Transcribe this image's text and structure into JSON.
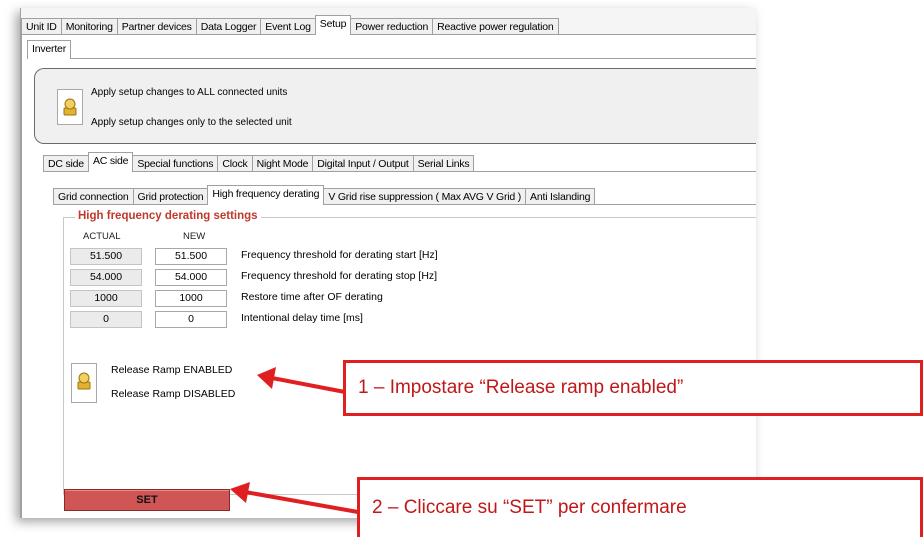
{
  "main_tabs": [
    {
      "label": "Unit ID",
      "active": false
    },
    {
      "label": "Monitoring",
      "active": false
    },
    {
      "label": "Partner devices",
      "active": false
    },
    {
      "label": "Data Logger",
      "active": false
    },
    {
      "label": "Event Log",
      "active": false
    },
    {
      "label": "Setup",
      "active": true
    },
    {
      "label": "Power reduction",
      "active": false
    },
    {
      "label": "Reactive power regulation",
      "active": false
    }
  ],
  "device_tab": "Inverter",
  "apply": {
    "all_units": "Apply setup changes to ALL connected units",
    "selected_unit": "Apply setup changes only to the selected unit"
  },
  "sub_tabs": [
    {
      "label": "DC side",
      "active": false
    },
    {
      "label": "AC side",
      "active": true
    },
    {
      "label": "Special functions",
      "active": false
    },
    {
      "label": "Clock",
      "active": false
    },
    {
      "label": "Night Mode",
      "active": false
    },
    {
      "label": "Digital Input / Output",
      "active": false
    },
    {
      "label": "Serial Links",
      "active": false
    }
  ],
  "ac_tabs": [
    {
      "label": "Grid connection",
      "active": false
    },
    {
      "label": "Grid protection",
      "active": false
    },
    {
      "label": "High frequency derating",
      "active": true
    },
    {
      "label": "V Grid rise suppression ( Max AVG V Grid )",
      "active": false
    },
    {
      "label": "Anti Islanding",
      "active": false
    }
  ],
  "settings": {
    "title": "High frequency derating settings",
    "col_actual": "ACTUAL",
    "col_new": "NEW",
    "rows": [
      {
        "actual": "51.500",
        "new": "51.500",
        "label": "Frequency threshold for derating start [Hz]"
      },
      {
        "actual": "54.000",
        "new": "54.000",
        "label": "Frequency threshold for derating stop [Hz]"
      },
      {
        "actual": "1000",
        "new": "1000",
        "label": "Restore time after OF derating"
      },
      {
        "actual": "0",
        "new": "0",
        "label": "Intentional delay time [ms]"
      }
    ]
  },
  "ramp": {
    "enabled": "Release Ramp ENABLED",
    "disabled": "Release Ramp DISABLED"
  },
  "set_button": "SET",
  "annotations": {
    "callout1": "1 – Impostare “Release ramp enabled”",
    "callout2": "2 – Cliccare su “SET” per confermare",
    "color": "#e02020"
  }
}
